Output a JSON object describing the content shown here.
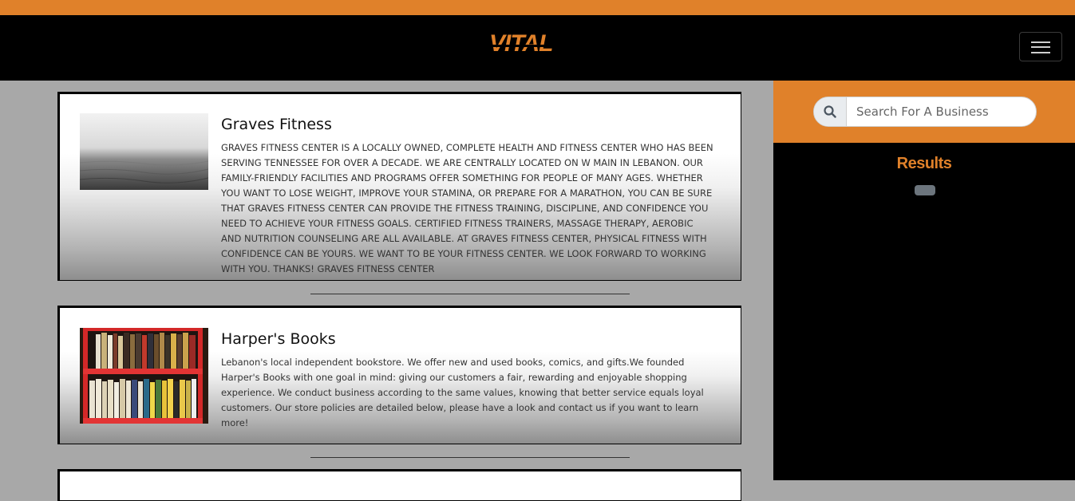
{
  "brand": {
    "logo_text": "VITAL",
    "accent_color": "#e0812a"
  },
  "nav": {
    "menu_icon": "hamburger-icon"
  },
  "search": {
    "placeholder": "Search For A Business",
    "icon": "search-icon"
  },
  "results": {
    "title": "Results",
    "badge_text": ""
  },
  "businesses": [
    {
      "name": "Graves Fitness",
      "description": "GRAVES FITNESS CENTER IS A LOCALLY OWNED, COMPLETE HEALTH AND FITNESS CENTER WHO HAS BEEN SERVING TENNESSEE FOR OVER A DECADE. WE ARE CENTRALLY LOCATED ON W MAIN IN LEBANON. OUR FAMILY-FRIENDLY FACILITIES AND PROGRAMS OFFER SOMETHING FOR PEOPLE OF MANY AGES. WHETHER YOU WANT TO LOSE WEIGHT, IMPROVE YOUR STAMINA, OR PREPARE FOR A MARATHON, YOU CAN BE SURE THAT GRAVES FITNESS CENTER CAN PROVIDE THE FITNESS TRAINING, DISCIPLINE, AND CONFIDENCE YOU NEED TO ACHIEVE YOUR FITNESS GOALS. CERTIFIED FITNESS TRAINERS, MASSAGE THERAPY, AEROBIC AND NUTRITION COUNSELING ARE ALL AVAILABLE. AT GRAVES FITNESS CENTER, PHYSICAL FITNESS WITH CONFIDENCE CAN BE YOURS. WE WANT TO BE YOUR FITNESS CENTER. WE LOOK FORWARD TO WORKING WITH YOU. THANKS! GRAVES FITNESS CENTER",
      "image": "foggy-sea-photo"
    },
    {
      "name": "Harper's Books",
      "description": "Lebanon's local independent bookstore. We offer new and used books, comics, and gifts.We founded Harper's Books with one goal in mind: giving our customers a fair, rewarding and enjoyable shopping experience. We conduct business according to the same values, knowing that better service equals loyal customers. Our store policies are detailed below, please have a look and contact us if you want to learn more!",
      "image": "bookshelf-photo"
    }
  ]
}
